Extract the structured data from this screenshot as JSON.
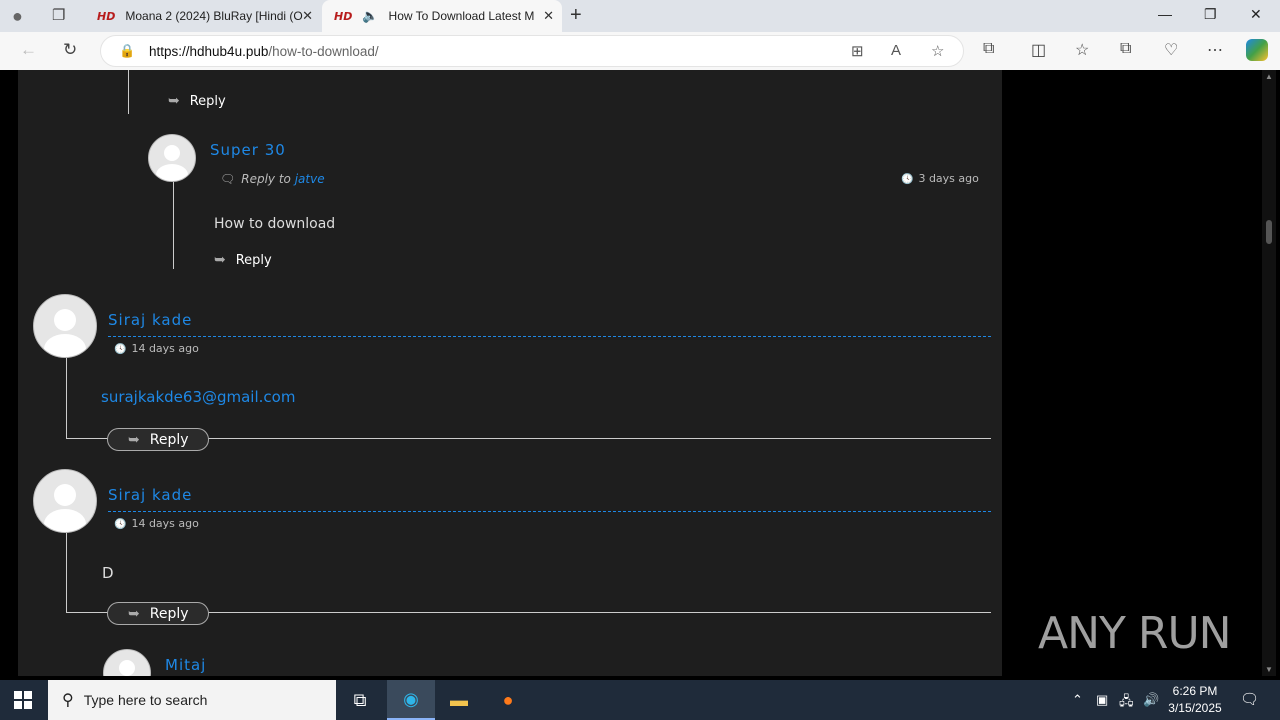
{
  "browser": {
    "tabs": [
      {
        "title": "Moana 2 (2024) BluRay [Hindi (O",
        "badge": "HD"
      },
      {
        "title": "How To Download Latest M",
        "badge": "HD"
      }
    ],
    "new_tab": "+",
    "url_host": "https://hdhub4u.pub",
    "url_path": "/how-to-download/"
  },
  "comments": {
    "top_reply_label": "Reply",
    "super30": {
      "name": "Super 30",
      "reply_prefix": "Reply to",
      "reply_to": "jatve",
      "time": "3 days ago",
      "text": "How to download",
      "reply_label": "Reply"
    },
    "siraj1": {
      "name": "Siraj kade",
      "time": "14 days ago",
      "text": "surajkakde63@gmail.com",
      "reply_label": "Reply"
    },
    "siraj2": {
      "name": "Siraj kade",
      "time": "14 days ago",
      "text": "D",
      "reply_label": "Reply"
    },
    "mitaj": {
      "name": "Mitaj"
    }
  },
  "watermark": "ANY RUN",
  "taskbar": {
    "search_placeholder": "Type here to search",
    "time": "6:26 PM",
    "date": "3/15/2025"
  },
  "colors": {
    "accent": "#1e88e5",
    "page_bg": "#1e1e1e",
    "taskbar": "#1f2b3a"
  }
}
